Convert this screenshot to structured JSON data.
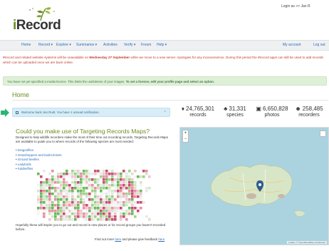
{
  "top": {
    "login_text": "Login as >> Jan R"
  },
  "brand": {
    "name": "Record",
    "name_prefix": "i"
  },
  "nav": {
    "items": [
      "Home",
      "Record ▾",
      "Explore ▾",
      "Summaries ▾",
      "Activities",
      "Verify ▾",
      "Forum",
      "Help ▾"
    ],
    "right": [
      "My account",
      "Log out"
    ]
  },
  "alerts": {
    "red_pre": "iRecord and related website systems will be unavailable on ",
    "red_bold": "Wednesday 27 September",
    "red_post": " while we move to a new server. Apologies for any inconvenience. During this period the iRecord apps can still be used to add records which can be uploaded once we are back online.",
    "green_pre": "You have not yet specified a media licence. This limits the usefulness of your images. ",
    "green_bold": "To set a licence, edit your profile page and select an option."
  },
  "page": {
    "title": "Home"
  },
  "welcome": {
    "text": "Welcome back Jan Ruitt. You have 1 unread notification.",
    "close": "×"
  },
  "targeting": {
    "title": "Could you make use of Targeting Records Maps?",
    "intro": "Designed to help wildlife recorders make the most of their time out recording records, Targeting Records Maps are available to guide you to where records of the following species are most needed:",
    "links": [
      "Dragonflies",
      "Grasshoppers and bushcrickets",
      "Ground beetles",
      "Ladybirds",
      "Soldierflies"
    ],
    "outro": "Hopefully these will inspire you to go out and record in new places or for record groups you haven't recorded before.",
    "findout_pre": "Find out more ",
    "findout_link1": "here",
    "findout_mid": " and please give feedback ",
    "findout_link2": "here"
  },
  "stats": [
    {
      "icon": "map-marker-icon",
      "glyph": "♦",
      "num": "24,765,301",
      "label": "records"
    },
    {
      "icon": "sitemap-icon",
      "glyph": "♣",
      "num": "31,331",
      "label": "species"
    },
    {
      "icon": "camera-icon",
      "glyph": "▣",
      "num": "6,650,828",
      "label": "photos"
    },
    {
      "icon": "users-icon",
      "glyph": "☻",
      "num": "258,485",
      "label": "recorders"
    }
  ],
  "map": {
    "zoom_in": "+",
    "zoom_out": "−",
    "attribution": "Leaflet | © OpenStreetMap contributors",
    "place_label": "Jersey",
    "sea_color": "#aad3df",
    "land_color": "#d8e6c8"
  },
  "colors": {
    "accent_green": "#6b8e23",
    "link_blue": "#2a6ebb",
    "alert_red": "#c0392b"
  }
}
